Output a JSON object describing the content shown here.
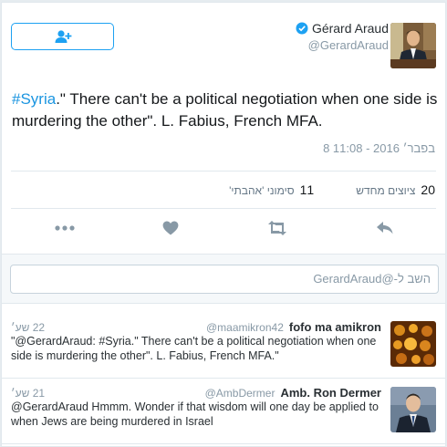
{
  "tweet": {
    "author_name": "Gérard Araud",
    "author_handle": "@GerardAraud",
    "verified_icon": "verified-badge-icon",
    "follow_icon": "add-user-icon",
    "hashtag": "#Syria",
    "text_rest": ".\" There can't be a political negotiation when one side is murdering the other\". L. Fabius, French MFA.",
    "timestamp": "8 בפבר׳ 2016 - 11:08",
    "retweets_count": "20",
    "retweets_label": "ציוצים מחדש",
    "likes_count": "11",
    "likes_label": "סימוני 'אהבתי'",
    "accent_color": "#1da1f2"
  },
  "actions": {
    "more_icon": "more-dots-icon",
    "like_icon": "heart-icon",
    "retweet_icon": "retweet-icon",
    "reply_icon": "reply-arrow-icon"
  },
  "reply_box": {
    "placeholder": "השב ל-@GerardAraud"
  },
  "replies": [
    {
      "name": "fofo ma amikron",
      "handle": "@maamikron42",
      "time": "22 שע׳",
      "text": "\"@GerardAraud: #Syria.\" There can't be a political negotiation when one side is murdering the other\". L. Fabius, French MFA.\""
    },
    {
      "name": "Amb. Ron Dermer",
      "handle": "@AmbDermer",
      "time": "21 שע׳",
      "text": "@GerardAraud Hmmm.  Wonder if that wisdom will one day be applied to when Jews are being murdered in Israel"
    }
  ]
}
